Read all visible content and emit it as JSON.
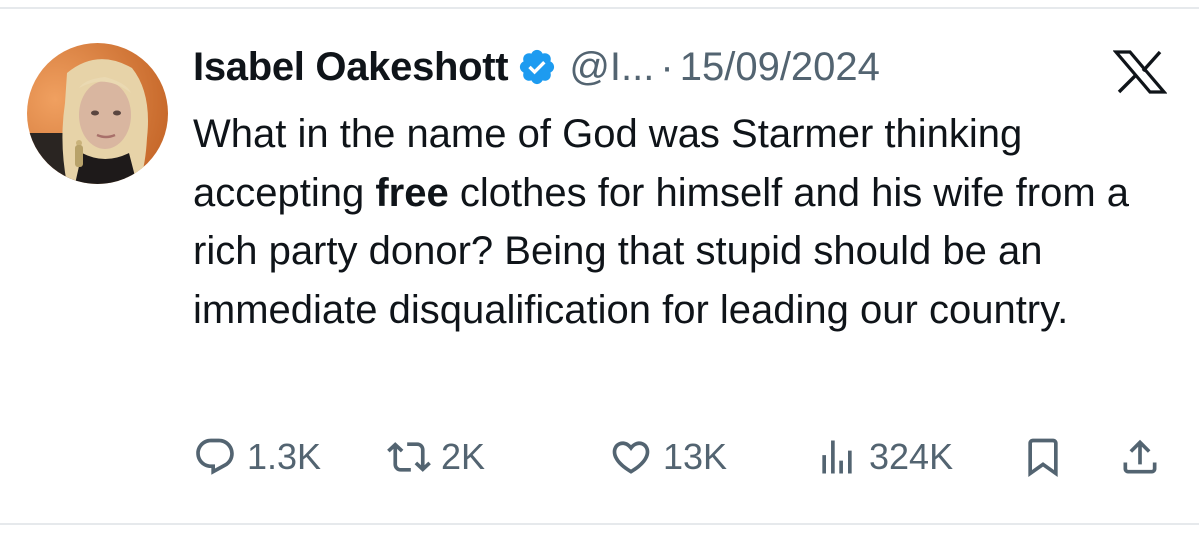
{
  "tweet": {
    "author_name": "Isabel Oakeshott",
    "handle": "@I...",
    "separator": "·",
    "date": "15/09/2024",
    "text_before": "What in the name of God was Starmer thinking accepting ",
    "text_bold": "free",
    "text_after": " clothes for himself and his wife from a rich party donor? Being that stupid should be an immediate disqualification for leading our country."
  },
  "metrics": {
    "replies": "1.3K",
    "reposts": "2K",
    "likes": "13K",
    "views": "324K"
  },
  "icons": {
    "verified": "verified-badge-icon",
    "platform": "x-logo-icon",
    "reply": "reply-icon",
    "repost": "repost-icon",
    "like": "heart-icon",
    "views": "views-icon",
    "bookmark": "bookmark-icon",
    "share": "share-icon"
  },
  "colors": {
    "verified_blue": "#1d9bf0",
    "text_primary": "#0f1419",
    "text_secondary": "#536471"
  }
}
